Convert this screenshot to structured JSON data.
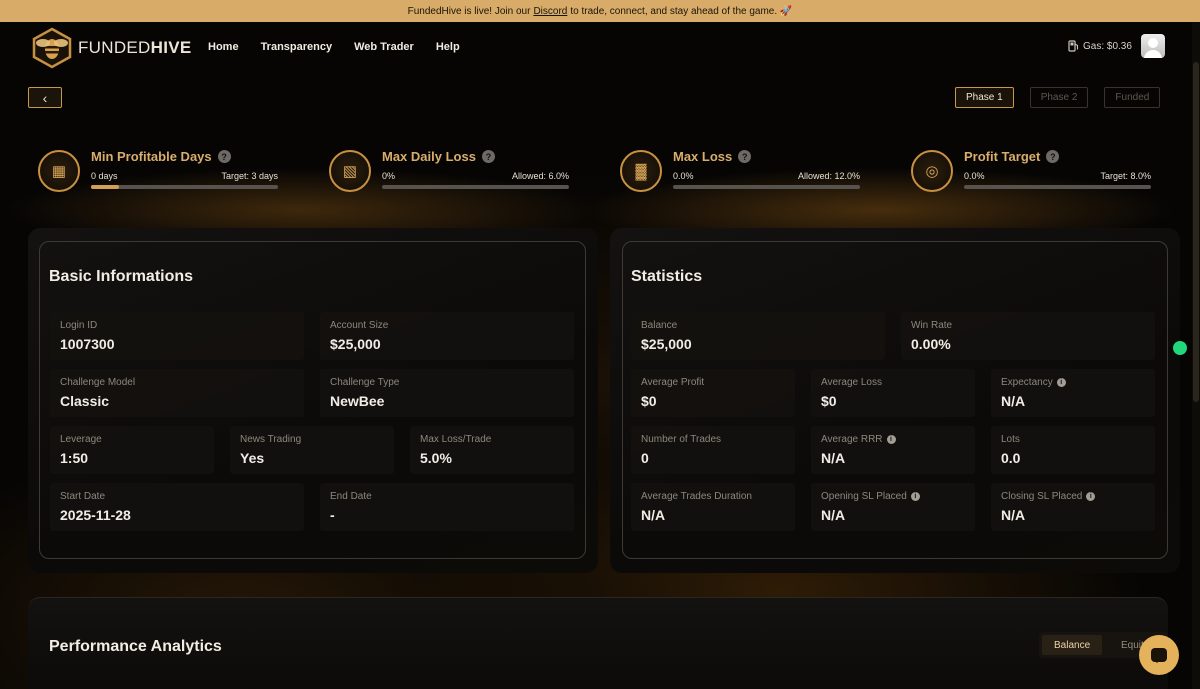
{
  "announcement": {
    "before": "FundedHive is live! Join our",
    "link": "Discord",
    "after": "to trade, connect, and stay ahead of the game. 🚀"
  },
  "brand": {
    "name_light": "FUNDED",
    "name_bold": "HIVE"
  },
  "nav": [
    "Home",
    "Transparency",
    "Web Trader",
    "Help"
  ],
  "gas": {
    "icon": "fuel-pump-icon",
    "label": "Gas: $0.36"
  },
  "back": {
    "icon": "chevron-left-icon",
    "glyph": "‹"
  },
  "phases": {
    "phase1": "Phase 1",
    "phase2": "Phase 2",
    "funded": "Funded"
  },
  "metrics": [
    {
      "title": "Min Profitable Days",
      "icon": "calendar-icon",
      "glyph": "▦",
      "value": "0 days",
      "target": "Target: 3 days",
      "progress": 0.15
    },
    {
      "title": "Max Daily Loss",
      "icon": "chart-frame-icon",
      "glyph": "▧",
      "value": "0%",
      "target": "Allowed: 6.0%",
      "progress": 0
    },
    {
      "title": "Max Loss",
      "icon": "bar-chart-icon",
      "glyph": "▓",
      "value": "0.0%",
      "target": "Allowed: 12.0%",
      "progress": 0
    },
    {
      "title": "Profit Target",
      "icon": "coins-icon",
      "glyph": "◎",
      "value": "0.0%",
      "target": "Target: 8.0%",
      "progress": 0
    }
  ],
  "basic": {
    "title": "Basic Informations",
    "login_id": {
      "label": "Login ID",
      "value": "1007300"
    },
    "account_size": {
      "label": "Account Size",
      "value": "$25,000"
    },
    "challenge_model": {
      "label": "Challenge Model",
      "value": "Classic"
    },
    "challenge_type": {
      "label": "Challenge Type",
      "value": "NewBee"
    },
    "leverage": {
      "label": "Leverage",
      "value": "1:50"
    },
    "news_trading": {
      "label": "News Trading",
      "value": "Yes"
    },
    "max_loss_trade": {
      "label": "Max Loss/Trade",
      "value": "5.0%"
    },
    "start_date": {
      "label": "Start Date",
      "value": "2025-11-28"
    },
    "end_date": {
      "label": "End Date",
      "value": "-"
    }
  },
  "stats": {
    "title": "Statistics",
    "balance": {
      "label": "Balance",
      "value": "$25,000"
    },
    "win_rate": {
      "label": "Win Rate",
      "value": "0.00%"
    },
    "avg_profit": {
      "label": "Average Profit",
      "value": "$0"
    },
    "avg_loss": {
      "label": "Average Loss",
      "value": "$0"
    },
    "expectancy": {
      "label": "Expectancy",
      "value": "N/A"
    },
    "num_trades": {
      "label": "Number of Trades",
      "value": "0"
    },
    "avg_rrr": {
      "label": "Average RRR",
      "value": "N/A"
    },
    "lots": {
      "label": "Lots",
      "value": "0.0"
    },
    "avg_duration": {
      "label": "Average Trades Duration",
      "value": "N/A"
    },
    "opening_sl": {
      "label": "Opening SL Placed",
      "value": "N/A"
    },
    "closing_sl": {
      "label": "Closing SL Placed",
      "value": "N/A"
    }
  },
  "performance": {
    "title": "Performance Analytics",
    "balance": "Balance",
    "equity": "Equity"
  },
  "info_glyph": "i",
  "help_glyph": "?"
}
